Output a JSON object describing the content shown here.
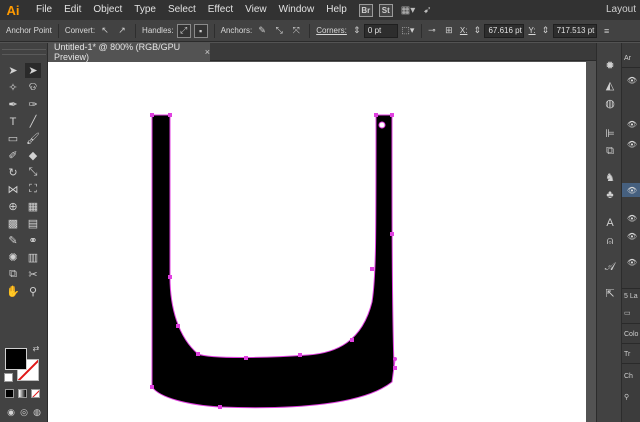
{
  "app": {
    "logo": "Ai",
    "workspace": "Layout"
  },
  "menu": [
    "File",
    "Edit",
    "Object",
    "Type",
    "Select",
    "Effect",
    "View",
    "Window",
    "Help"
  ],
  "menubar_badges": [
    "Br",
    "St"
  ],
  "control": {
    "selection_label": "Anchor Point",
    "convert_label": "Convert:",
    "handles_label": "Handles:",
    "anchors_label": "Anchors:",
    "corners_label": "Corners:",
    "corners_value": "0 pt",
    "x_label": "X:",
    "x_value": "67.616 pt",
    "y_label": "Y:",
    "y_value": "717.513 pt"
  },
  "document": {
    "tab_title": "Untitled-1* @ 800% (RGB/GPU Preview)",
    "close_glyph": "×"
  },
  "colors": {
    "selection_path": "#e040e0",
    "fill": "#000000",
    "stroke_none_slash": "#e01818",
    "accent": "#ff9a00"
  },
  "panels": {
    "layers_label": "5 La",
    "colors_label": "Colo",
    "transparency_label": "Tr",
    "character_label": "Ch"
  }
}
